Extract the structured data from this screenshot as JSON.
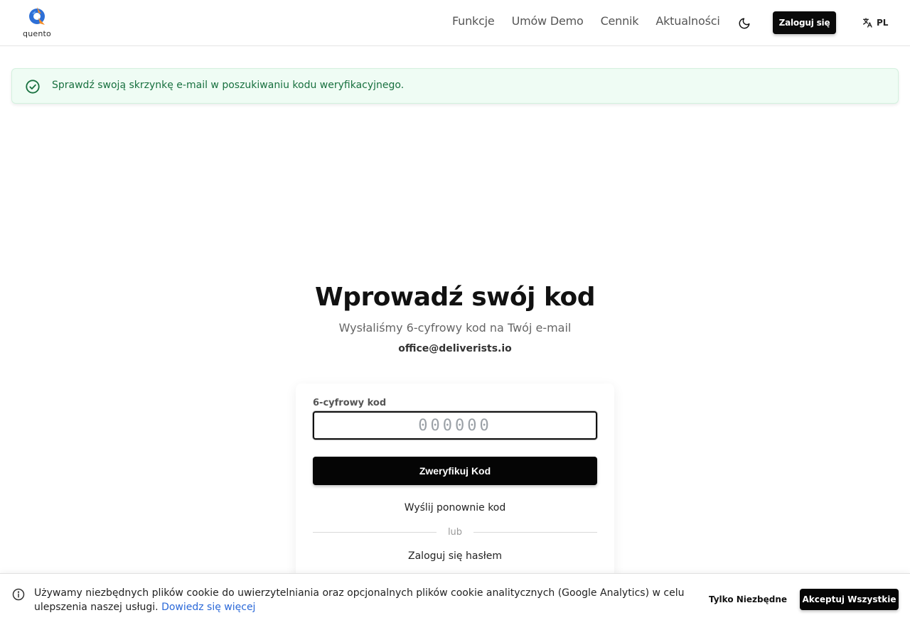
{
  "header": {
    "logo_text": "quento",
    "nav": [
      {
        "label": "Funkcje"
      },
      {
        "label": "Umów Demo"
      },
      {
        "label": "Cennik"
      },
      {
        "label": "Aktualności"
      }
    ],
    "login_label": "Zaloguj się",
    "language": "PL",
    "theme_icon": "moon-icon"
  },
  "alert": {
    "text": "Sprawdź swoją skrzynkę e-mail w poszukiwaniu kodu weryfikacyjnego.",
    "icon": "check-circle-icon",
    "color": "#18703f"
  },
  "main": {
    "title": "Wprowadź swój kod",
    "subtitle": "Wysłaliśmy 6-cyfrowy kod na Twój e-mail",
    "email": "office@deliverists.io",
    "form": {
      "code_label": "6-cyfrowy kod",
      "code_value": "",
      "code_placeholder": "000000",
      "verify_label": "Zweryfikuj Kod",
      "resend_label": "Wyślij ponownie kod",
      "divider_text": "lub",
      "password_login_label": "Zaloguj się hasłem"
    }
  },
  "cookie": {
    "text": "Używamy niezbędnych plików cookie do uwierzytelniania oraz opcjonalnych plików cookie analitycznych (Google Analytics) w celu ulepszenia naszej usługi.",
    "learn_more": "Dowiedz się więcej",
    "necessary_label": "Tylko Niezbędne",
    "accept_label": "Akceptuj Wszystkie",
    "link_color": "#2a68d8"
  }
}
